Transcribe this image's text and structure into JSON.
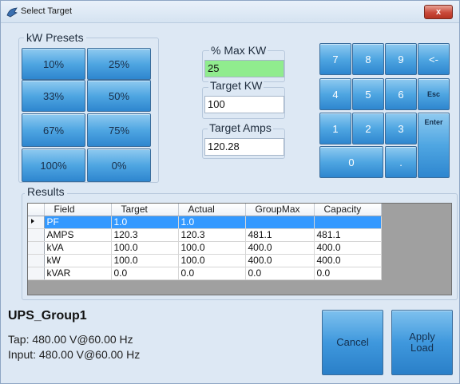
{
  "window": {
    "title": "Select Target",
    "close_label": "x"
  },
  "presets": {
    "label": "kW Presets",
    "buttons": [
      "10%",
      "25%",
      "33%",
      "50%",
      "67%",
      "75%",
      "100%",
      "0%"
    ]
  },
  "fields": {
    "max_kw_label": "% Max KW",
    "max_kw_value": "25",
    "target_kw_label": "Target KW",
    "target_kw_value": "100",
    "target_amps_label": "Target Amps",
    "target_amps_value": "120.28"
  },
  "keypad": {
    "keys": [
      "7",
      "8",
      "9",
      "<-",
      "4",
      "5",
      "6",
      "Esc",
      "1",
      "2",
      "3",
      "Enter",
      "0",
      "."
    ]
  },
  "results": {
    "label": "Results",
    "columns": [
      "Field",
      "Target",
      "Actual",
      "GroupMax",
      "Capacity"
    ],
    "rows": [
      [
        "PF",
        "1.0",
        "1.0",
        "",
        ""
      ],
      [
        "AMPS",
        "120.3",
        "120.3",
        "481.1",
        "481.1"
      ],
      [
        "kVA",
        "100.0",
        "100.0",
        "400.0",
        "400.0"
      ],
      [
        "kW",
        "100.0",
        "100.0",
        "400.0",
        "400.0"
      ],
      [
        "kVAR",
        "0.0",
        "0.0",
        "0.0",
        "0.0"
      ]
    ],
    "selected_row": 0
  },
  "group": {
    "name": "UPS_Group1",
    "tap": "Tap: 480.00 V@60.00 Hz",
    "input": "Input: 480.00 V@60.00 Hz"
  },
  "actions": {
    "cancel_label": "Cancel",
    "apply_label_line1": "Apply",
    "apply_label_line2": "Load"
  },
  "colors": {
    "button_blue": "#4fa6e2",
    "selected_row": "#3399ff",
    "active_field": "#90ec8e"
  }
}
